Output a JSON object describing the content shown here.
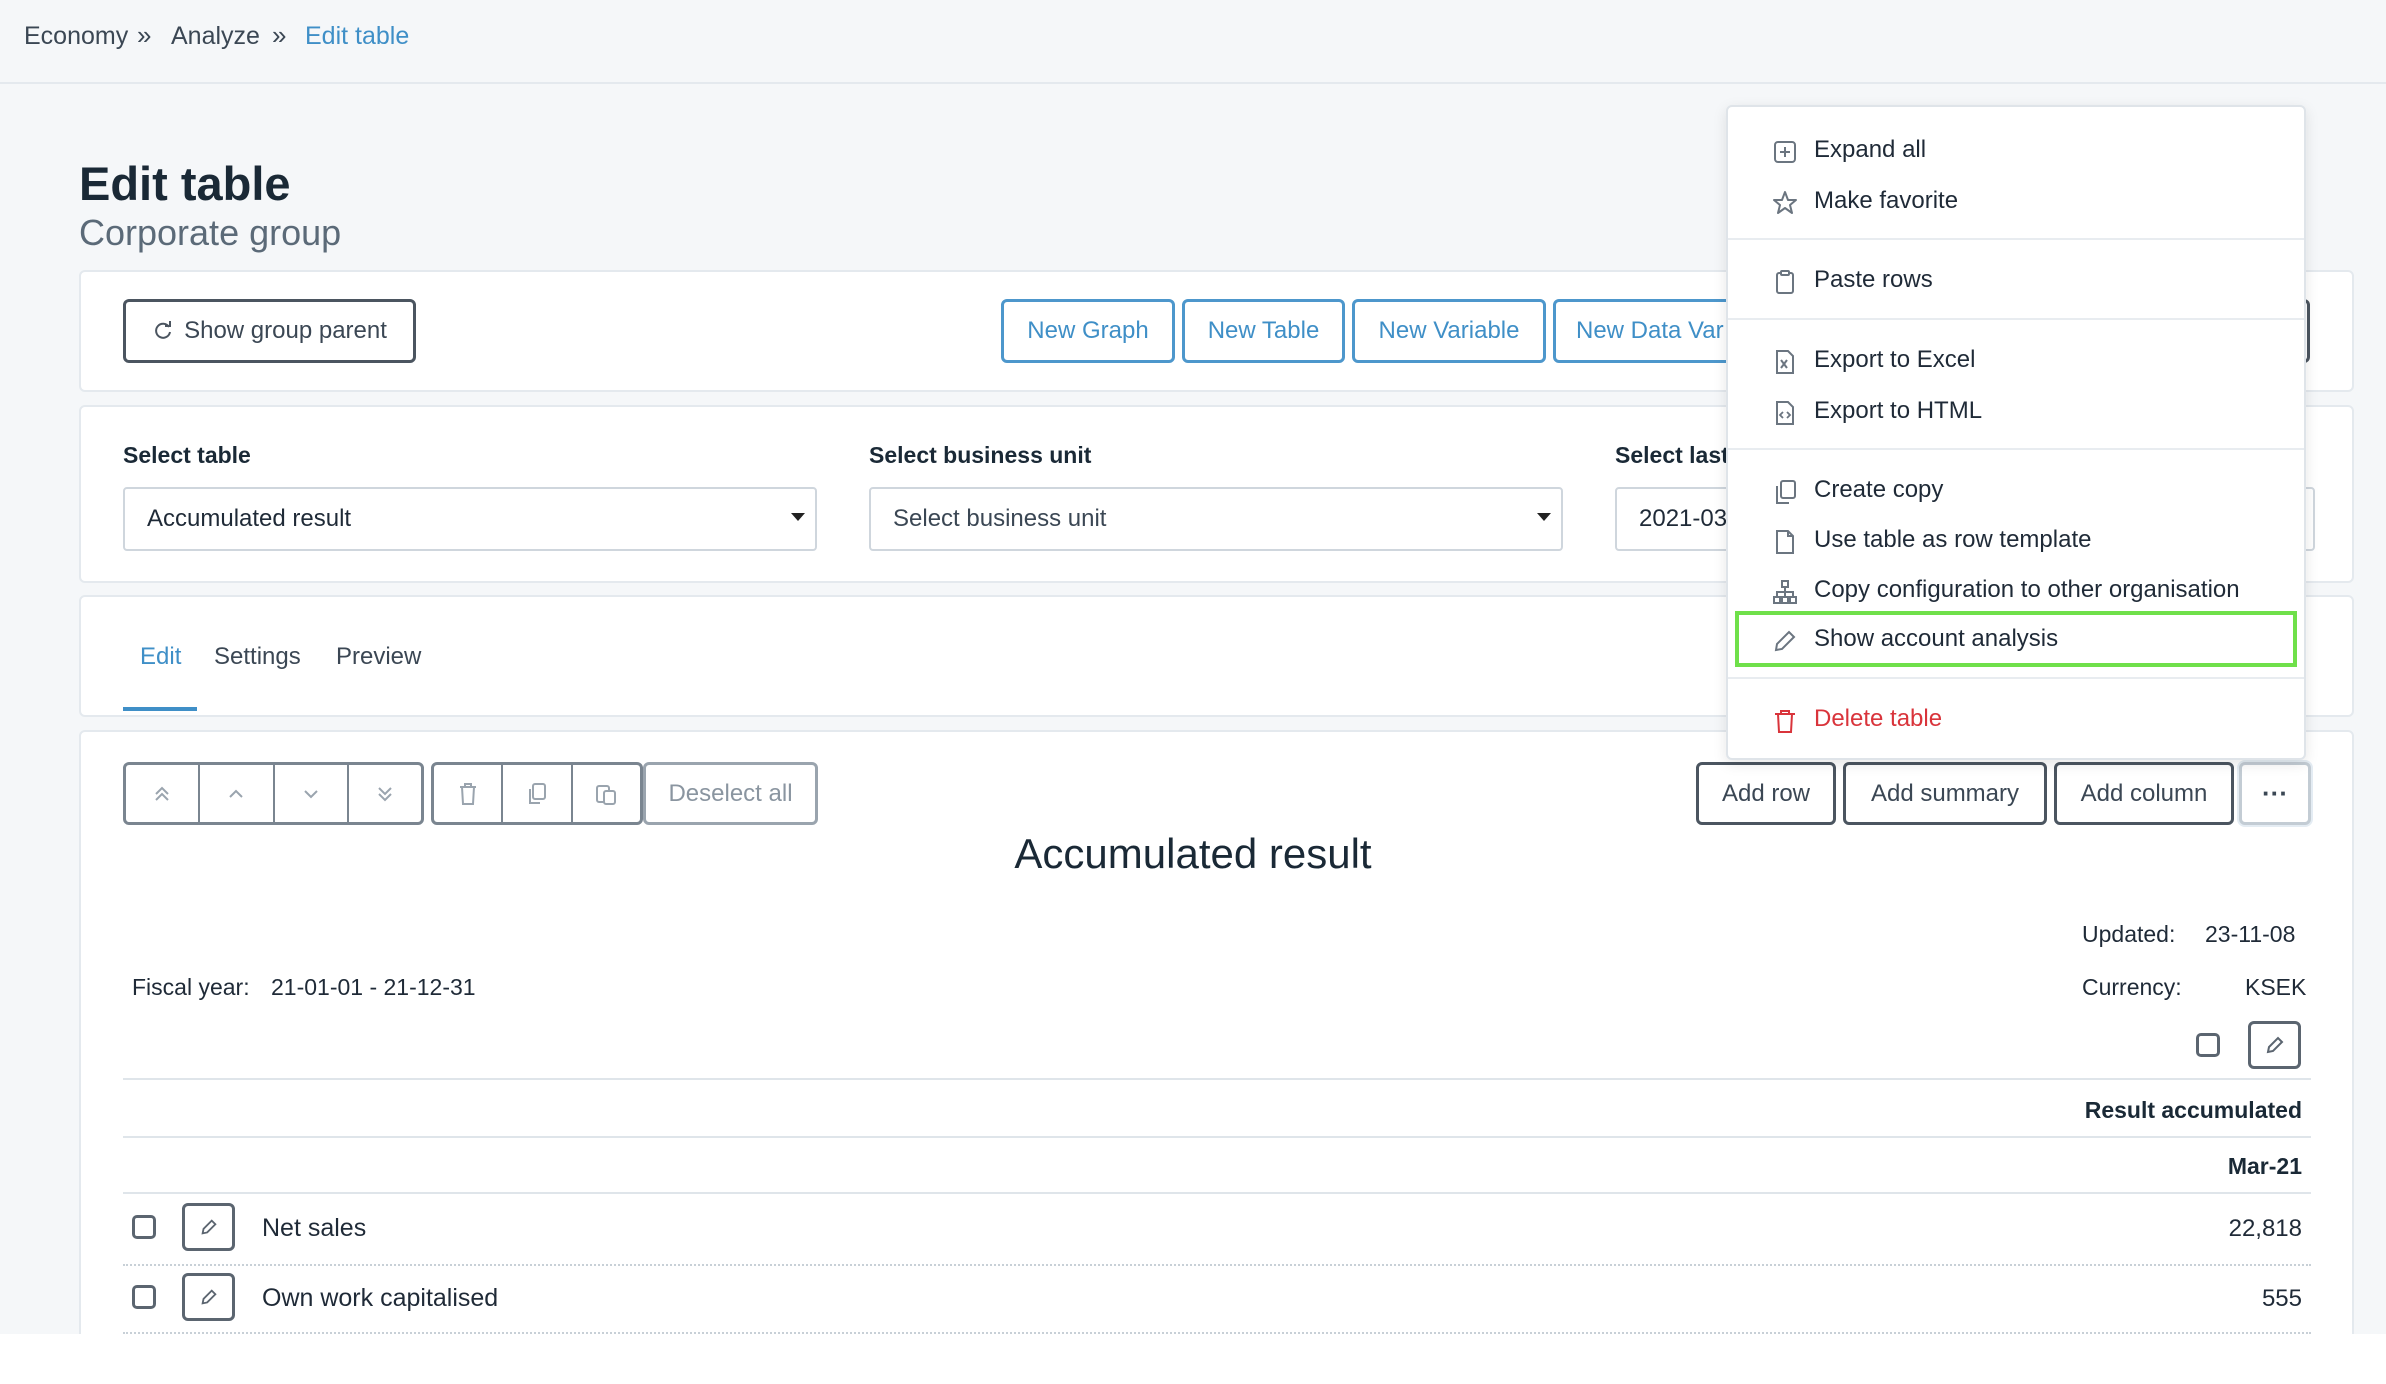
{
  "breadcrumb": {
    "items": [
      "Economy",
      "Analyze",
      "Edit table"
    ]
  },
  "page": {
    "title": "Edit table",
    "subtitle": "Corporate group"
  },
  "toolbar": {
    "show_group_parent": "Show group parent",
    "new_graph": "New Graph",
    "new_table": "New Table",
    "new_variable": "New Variable",
    "new_data_var": "New Data Var"
  },
  "filters": {
    "select_table_label": "Select table",
    "select_table_value": "Accumulated result",
    "business_unit_label": "Select business unit",
    "business_unit_placeholder": "Select business unit",
    "last_label": "Select last",
    "last_value": "2021-03"
  },
  "tabs": [
    "Edit",
    "Settings",
    "Preview"
  ],
  "editor": {
    "deselect_all": "Deselect all",
    "add_row": "Add row",
    "add_summary": "Add summary",
    "add_column": "Add column",
    "more": "···"
  },
  "table": {
    "title": "Accumulated result",
    "fiscal_year_label": "Fiscal year:",
    "fiscal_year_value": "21-01-01 - 21-12-31",
    "updated_label": "Updated:",
    "updated_value": "23-11-08",
    "currency_label": "Currency:",
    "currency_value": "KSEK",
    "column_header": "Result accumulated",
    "column_period": "Mar-21",
    "rows": [
      {
        "label": "Net sales",
        "value": "22,818"
      },
      {
        "label": "Own work capitalised",
        "value": "555"
      }
    ]
  },
  "menu": {
    "expand_all": "Expand all",
    "make_favorite": "Make favorite",
    "paste_rows": "Paste rows",
    "export_excel": "Export to Excel",
    "export_html": "Export to HTML",
    "create_copy": "Create copy",
    "use_as_row_template": "Use table as row template",
    "copy_configuration": "Copy configuration to other organisation",
    "show_account_analysis": "Show account analysis",
    "delete_table": "Delete table"
  },
  "colors": {
    "accent": "#3f8fc7",
    "danger": "#d9343b",
    "highlight": "#6fe04a"
  }
}
